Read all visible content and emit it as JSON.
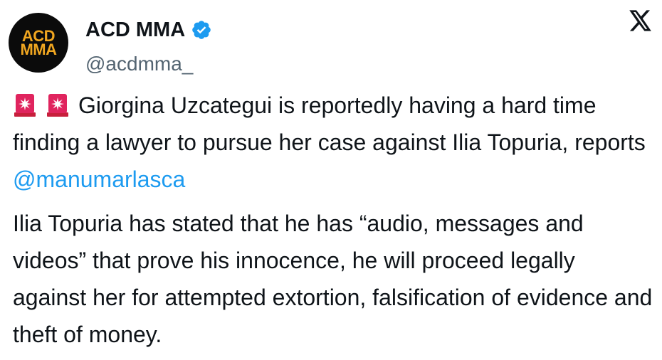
{
  "author": {
    "avatar_line1": "ACD",
    "avatar_line2": "MMA",
    "display_name": "ACD MMA",
    "handle": "@acdmma_",
    "verified_icon": "verified-badge-icon"
  },
  "brand": {
    "logo_icon": "x-logo-icon"
  },
  "tweet": {
    "emoji_1": "siren-emoji",
    "emoji_2": "siren-emoji",
    "para1_text": "Giorgina Uzcategui is reportedly having a hard time finding a lawyer to pursue her case against Ilia Topuria, reports ",
    "para1_mention": "@manumarlasca",
    "para2_text": "Ilia Topuria has stated that he has “audio, messages and videos” that prove his innocence, he will proceed legally against her for attempted extortion, falsification of evidence and theft of money."
  },
  "colors": {
    "text": "#0f1419",
    "handle": "#536471",
    "link": "#1d9bf0",
    "verified": "#1d9bf0",
    "avatar_bg": "#0b0b0b",
    "avatar_text": "#f0a620",
    "siren": "#e0245e"
  }
}
